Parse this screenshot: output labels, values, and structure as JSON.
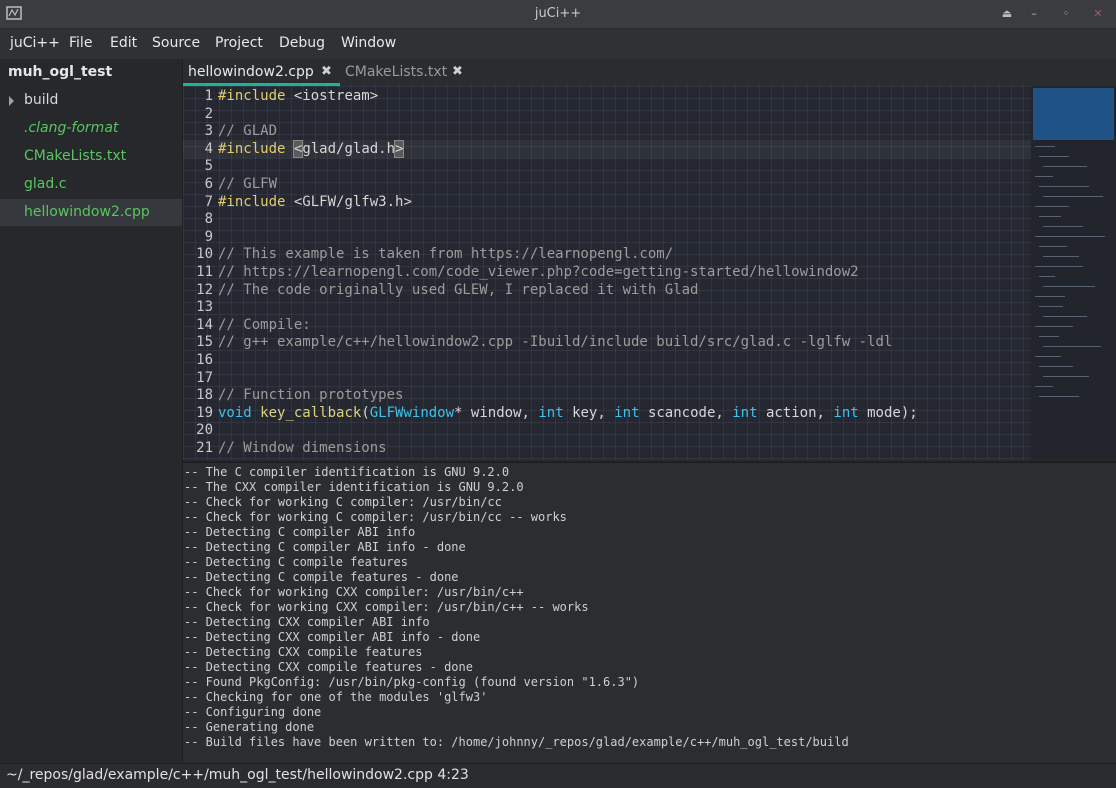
{
  "window": {
    "title": "juCi++"
  },
  "menu": [
    "juCi++",
    "File",
    "Edit",
    "Source",
    "Project",
    "Debug",
    "Window"
  ],
  "sidebar": {
    "project": "muh_ogl_test",
    "items": [
      {
        "label": "build",
        "color": "#d8d8d8",
        "folder": true
      },
      {
        "label": ".clang-format",
        "color": "#58c760",
        "italic": true
      },
      {
        "label": "CMakeLists.txt",
        "color": "#58c760"
      },
      {
        "label": "glad.c",
        "color": "#58c760"
      },
      {
        "label": "hellowindow2.cpp",
        "color": "#58c760",
        "selected": true
      }
    ]
  },
  "tabs": [
    {
      "label": "hellowindow2.cpp",
      "active": true
    },
    {
      "label": "CMakeLists.txt",
      "active": false
    }
  ],
  "editor": {
    "lines": [
      {
        "n": "1",
        "tokens": [
          [
            "kw-pp",
            "#include"
          ],
          [
            "",
            " <iostream>"
          ]
        ]
      },
      {
        "n": "2",
        "tokens": []
      },
      {
        "n": "3",
        "tokens": [
          [
            "cmt",
            "// GLAD"
          ]
        ]
      },
      {
        "n": "4",
        "current": true,
        "tokens": [
          [
            "kw-pp",
            "#include"
          ],
          [
            "",
            " "
          ],
          [
            "bracket",
            "<"
          ],
          [
            "",
            "glad/glad.h"
          ],
          [
            "bracket",
            ">"
          ]
        ]
      },
      {
        "n": "5",
        "tokens": []
      },
      {
        "n": "6",
        "tokens": [
          [
            "cmt",
            "// GLFW"
          ]
        ]
      },
      {
        "n": "7",
        "tokens": [
          [
            "kw-pp",
            "#include"
          ],
          [
            "",
            " <GLFW/glfw3.h>"
          ]
        ]
      },
      {
        "n": "8",
        "tokens": []
      },
      {
        "n": "9",
        "tokens": []
      },
      {
        "n": "10",
        "tokens": [
          [
            "cmt",
            "// This example is taken from https://learnopengl.com/"
          ]
        ]
      },
      {
        "n": "11",
        "tokens": [
          [
            "cmt",
            "// https://learnopengl.com/code_viewer.php?code=getting-started/hellowindow2"
          ]
        ]
      },
      {
        "n": "12",
        "tokens": [
          [
            "cmt",
            "// The code originally used GLEW, I replaced it with Glad"
          ]
        ]
      },
      {
        "n": "13",
        "tokens": []
      },
      {
        "n": "14",
        "tokens": [
          [
            "cmt",
            "// Compile:"
          ]
        ]
      },
      {
        "n": "15",
        "tokens": [
          [
            "cmt",
            "// g++ example/c++/hellowindow2.cpp -Ibuild/include build/src/glad.c -lglfw -ldl"
          ]
        ]
      },
      {
        "n": "16",
        "tokens": []
      },
      {
        "n": "17",
        "tokens": []
      },
      {
        "n": "18",
        "tokens": [
          [
            "cmt",
            "// Function prototypes"
          ]
        ]
      },
      {
        "n": "19",
        "tokens": [
          [
            "kw",
            "void"
          ],
          [
            "",
            " "
          ],
          [
            "fn",
            "key_callback"
          ],
          [
            "",
            "("
          ],
          [
            "type",
            "GLFWwindow"
          ],
          [
            "",
            "* window, "
          ],
          [
            "kw",
            "int"
          ],
          [
            "",
            " key, "
          ],
          [
            "kw",
            "int"
          ],
          [
            "",
            " scancode, "
          ],
          [
            "kw",
            "int"
          ],
          [
            "",
            " action, "
          ],
          [
            "kw",
            "int"
          ],
          [
            "",
            " mode);"
          ]
        ]
      },
      {
        "n": "20",
        "tokens": []
      },
      {
        "n": "21",
        "tokens": [
          [
            "cmt",
            "// Window dimensions"
          ]
        ]
      }
    ]
  },
  "terminal": {
    "lines": [
      "-- The C compiler identification is GNU 9.2.0",
      "-- The CXX compiler identification is GNU 9.2.0",
      "-- Check for working C compiler: /usr/bin/cc",
      "-- Check for working C compiler: /usr/bin/cc -- works",
      "-- Detecting C compiler ABI info",
      "-- Detecting C compiler ABI info - done",
      "-- Detecting C compile features",
      "-- Detecting C compile features - done",
      "-- Check for working CXX compiler: /usr/bin/c++",
      "-- Check for working CXX compiler: /usr/bin/c++ -- works",
      "-- Detecting CXX compiler ABI info",
      "-- Detecting CXX compiler ABI info - done",
      "-- Detecting CXX compile features",
      "-- Detecting CXX compile features - done",
      "-- Found PkgConfig: /usr/bin/pkg-config (found version \"1.6.3\")",
      "-- Checking for one of the modules 'glfw3'",
      "-- Configuring done",
      "-- Generating done",
      "-- Build files have been written to: /home/johnny/_repos/glad/example/c++/muh_ogl_test/build"
    ]
  },
  "status": {
    "path": "~/_repos/glad/example/c++/muh_ogl_test/hellowindow2.cpp",
    "cursor": "4:23"
  }
}
